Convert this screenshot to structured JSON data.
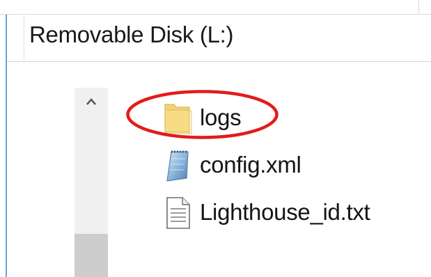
{
  "address_bar": {
    "path": "Removable Disk (L:)"
  },
  "scrollbar": {
    "up_arrow": "^"
  },
  "files": [
    {
      "name": "logs",
      "type": "folder",
      "icon": "folder-icon",
      "highlighted": true
    },
    {
      "name": "config.xml",
      "type": "xml",
      "icon": "xml-file-icon",
      "highlighted": false
    },
    {
      "name": "Lighthouse_id.txt",
      "type": "txt",
      "icon": "text-file-icon",
      "highlighted": false
    }
  ],
  "colors": {
    "highlight": "#e31b1b",
    "folder": "#f3d376",
    "frame_accent": "#6f9fd8"
  }
}
